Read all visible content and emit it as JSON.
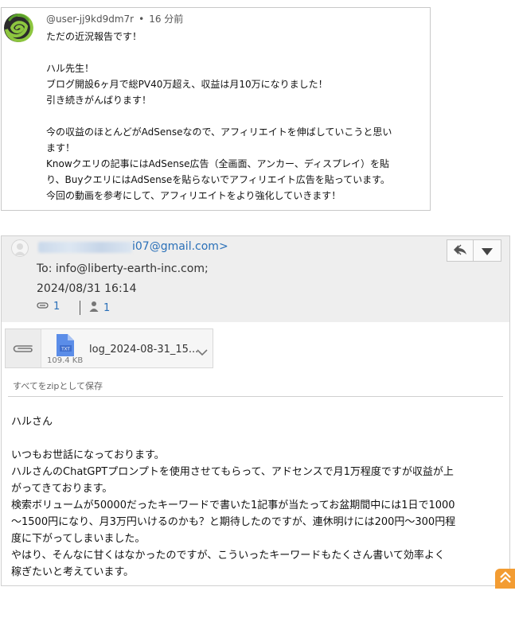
{
  "comment": {
    "username": "@user-jj9kd9dm7r",
    "separator": "•",
    "time": "16 分前",
    "lines": [
      "ただの近況報告です！",
      "",
      "ハル先生！",
      "ブログ開設6ヶ月で総PV40万超え、収益は月10万になりました！",
      "引き続きがんばります！",
      "",
      "今の収益のほとんどがAdSenseなので、アフィリエイトを伸ばしていこうと思い",
      "ます！",
      "Knowクエリの記事にはAdSense広告（全画面、アンカー、ディスプレイ）を貼",
      "り、BuyクエリにはAdSenseを貼らないでアフィリエイト広告を貼っています。",
      "今回の動画を参考にして、アフィリエイトをより強化していきます！"
    ]
  },
  "email": {
    "from_visible": "i07@gmail.com>",
    "to": "To: info@liberty-earth-inc.com;",
    "date": "2024/08/31 16:14",
    "attachment_count": "1",
    "recipient_count": "1",
    "attachment": {
      "name": "log_2024-08-31_15...",
      "size": "109.4 KB",
      "type_label": "TXT"
    },
    "save_zip": "すべてをzipとして保存",
    "body_lines": [
      "ハルさん",
      "",
      "いつもお世話になっております。",
      "ハルさんのChatGPTプロンプトを使用させてもらって、アドセンスで月1万程度ですが収益が上",
      "がってきております。",
      "検索ボリュームが50000だったキーワードで書いた1記事が当たってお盆期間中には1日で1000",
      "〜1500円になり、月3万円いけるのかも？と期待したのですが、連休明けには200円〜300円程",
      "度に下がってしまいました。",
      "やはり、そんなに甘くはなかったのですが、こういったキーワードもたくさん書いて効率よく",
      "稼ぎたいと考えています。"
    ]
  },
  "colors": {
    "link": "#2a70b8",
    "header_bg": "#eeeeee",
    "scroll_button": "#f39c32"
  },
  "icons": [
    "spiral-avatar-icon",
    "user-avatar-icon",
    "reply-icon",
    "dropdown-arrow-icon",
    "attachment-icon",
    "person-icon",
    "paperclip-icon",
    "txt-file-icon",
    "chevron-down-icon",
    "scroll-top-icon"
  ]
}
